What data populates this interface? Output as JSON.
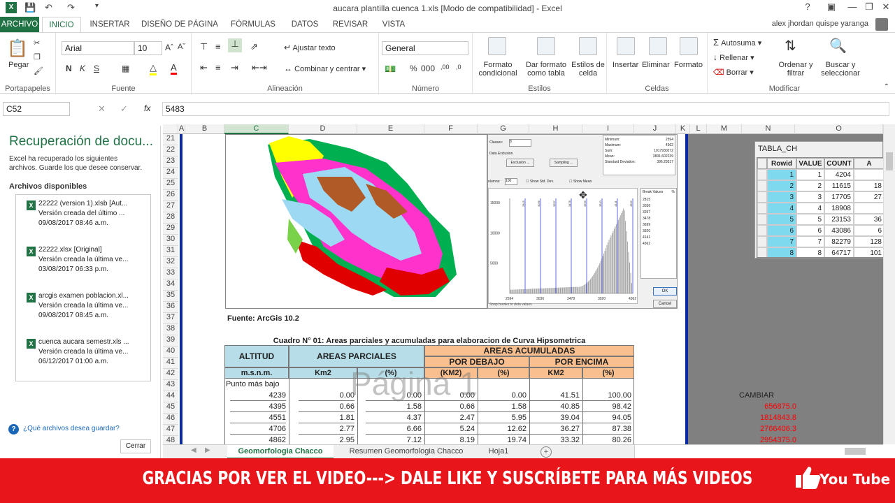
{
  "window": {
    "title": "aucara plantilla cuenca 1.xls  [Modo de compatibilidad] - Excel",
    "user": "alex jhordan quispe yaranga"
  },
  "tabs": [
    "ARCHIVO",
    "INICIO",
    "INSERTAR",
    "DISEÑO DE PÁGINA",
    "FÓRMULAS",
    "DATOS",
    "REVISAR",
    "VISTA"
  ],
  "ribbon": {
    "clipboard": {
      "paste": "Pegar",
      "label": "Portapapeles"
    },
    "font": {
      "name": "Arial",
      "size": "10",
      "label": "Fuente"
    },
    "alignment": {
      "wrap": "Ajustar texto",
      "merge": "Combinar y centrar",
      "label": "Alineación"
    },
    "number": {
      "format": "General",
      "label": "Número"
    },
    "styles": {
      "cond1": "Formato",
      "cond2": "condicional",
      "table1": "Dar formato",
      "table2": "como tabla",
      "cell1": "Estilos de",
      "cell2": "celda",
      "label": "Estilos"
    },
    "cells": {
      "insert": "Insertar",
      "delete": "Eliminar",
      "format": "Formato",
      "label": "Celdas"
    },
    "modify": {
      "autosum": "Autosuma",
      "fill": "Rellenar",
      "clear": "Borrar",
      "sort1": "Ordenar y",
      "sort2": "filtrar",
      "find1": "Buscar y",
      "find2": "seleccionar",
      "label": "Modificar"
    }
  },
  "formula": {
    "namebox": "C52",
    "fx": "fx",
    "value": "5483"
  },
  "recovery": {
    "title": "Recuperación de docu...",
    "desc1": "Excel ha recuperado los siguientes",
    "desc2": "archivos. Guarde los que desee conservar.",
    "available": "Archivos disponibles",
    "files": [
      {
        "name": "22222 (version 1).xlsb  [Aut...",
        "line2": "Versión creada del último ...",
        "date": "09/08/2017 08:46 a.m."
      },
      {
        "name": "22222.xlsx  [Original]",
        "line2": "Versión creada la última ve...",
        "date": "03/08/2017 06:33 p.m."
      },
      {
        "name": "arcgis examen poblacion.xl...",
        "line2": "Versión creada la última ve...",
        "date": "09/08/2017 08:45 a.m."
      },
      {
        "name": "cuenca aucara semestr.xls  ...",
        "line2": "Versión creada la última ve...",
        "date": "06/12/2017 01:00 a.m."
      }
    ],
    "question": "¿Qué archivos desea guardar?",
    "close": "Cerrar"
  },
  "columns": [
    "A",
    "B",
    "C",
    "D",
    "E",
    "F",
    "G",
    "H",
    "I",
    "J",
    "K",
    "L",
    "M",
    "N",
    "O"
  ],
  "rows": [
    "21",
    "22",
    "23",
    "24",
    "25",
    "26",
    "27",
    "28",
    "29",
    "30",
    "31",
    "32",
    "33",
    "34",
    "35",
    "36",
    "37",
    "38",
    "39",
    "40",
    "41",
    "42",
    "43",
    "44",
    "45",
    "46",
    "47",
    "48"
  ],
  "sheet": {
    "source": "Fuente: ArcGis 10.2",
    "caption": "Cuadro N° 01: Areas parciales y acumuladas para elaboracion de Curva Hipsometrica",
    "h_altitud": "ALTITUD",
    "h_areas_parciales": "AREAS PARCIALES",
    "h_areas_acum": "AREAS ACUMULADAS",
    "h_debajo": "POR DEBAJO",
    "h_encima": "POR ENCIMA",
    "u_msnm": "m.s.n.m.",
    "u_km2": "Km2",
    "u_pct": "(%)",
    "u_km2b": "(KM2)",
    "u_pct2": "(%)",
    "u_km2c": "KM2",
    "u_pct3": "(%)",
    "first_row": "Punto más bajo",
    "watermark": "Página 1",
    "data": [
      [
        "4239",
        "0.00",
        "0.00",
        "0.00",
        "0.00",
        "41.51",
        "100.00"
      ],
      [
        "4395",
        "0.66",
        "1.58",
        "0.66",
        "1.58",
        "40.85",
        "98.42"
      ],
      [
        "4551",
        "1.81",
        "4.37",
        "2.47",
        "5.95",
        "39.04",
        "94.05"
      ],
      [
        "4706",
        "2.77",
        "6.66",
        "5.24",
        "12.62",
        "36.27",
        "87.38"
      ],
      [
        "4862",
        "2.95",
        "7.12",
        "8.19",
        "19.74",
        "33.32",
        "80.26"
      ]
    ],
    "cambiar": "CAMBIAR",
    "cambiar_vals": [
      "656875.0",
      "1814843.8",
      "2766406.3",
      "2954375.0"
    ]
  },
  "dialog": {
    "classes_label": "Classes:",
    "classes_val": "8",
    "exclusion_label": "Data Exclusion",
    "exclusion_btn": "Exclusion ...",
    "sampling_btn": "Sampling ...",
    "columns_label": "olumns:",
    "columns_val": "100",
    "std": "Show Std. Dev.",
    "mean": "Show Mean",
    "stats": [
      "Minimum:",
      "Maximum:",
      "Sum:",
      "Mean:",
      "Standard Deviation:"
    ],
    "stat_vals": [
      "2594",
      "4362",
      "1017930272",
      "3831.602239",
      "396.29317"
    ],
    "y_ticks": [
      "15000",
      "10000",
      "5000"
    ],
    "x_ticks": [
      "2594",
      "3036",
      "3478",
      "3920",
      "4362"
    ],
    "breaks_label": "Break Values",
    "breaks_pct": "%",
    "breaks": [
      "2815",
      "3036",
      "3257",
      "3478",
      "3699",
      "3920",
      "4141",
      "4362"
    ],
    "snap": "Snap breaks to data values",
    "ok": "OK",
    "cancel": "Cancel"
  },
  "tabla": {
    "title": "TABLA_CH",
    "headers": [
      "Rowid",
      "VALUE",
      "COUNT",
      "A"
    ],
    "rows": [
      [
        "1",
        "1",
        "4204",
        ""
      ],
      [
        "2",
        "2",
        "11615",
        "18"
      ],
      [
        "3",
        "3",
        "17705",
        "27"
      ],
      [
        "4",
        "4",
        "18908",
        ""
      ],
      [
        "5",
        "5",
        "23153",
        "36"
      ],
      [
        "6",
        "6",
        "43086",
        "6"
      ],
      [
        "7",
        "7",
        "82279",
        "128"
      ],
      [
        "8",
        "8",
        "64717",
        "101"
      ]
    ]
  },
  "sheet_tabs": [
    "Geomorfologia Chacco",
    "Resumen Geomorfologia Chacco",
    "Hoja1"
  ],
  "banner": {
    "text": "GRACIAS POR VER EL VIDEO---> DALE LIKE Y SUSCRÍBETE PARA MÁS VIDEOS",
    "yt": "You Tube"
  },
  "colors": {
    "excel_green": "#217346",
    "header_blue": "#b7dee8",
    "header_orange": "#fabf8f",
    "banner_red": "#e8161b",
    "negative_red": "#ff0000"
  }
}
